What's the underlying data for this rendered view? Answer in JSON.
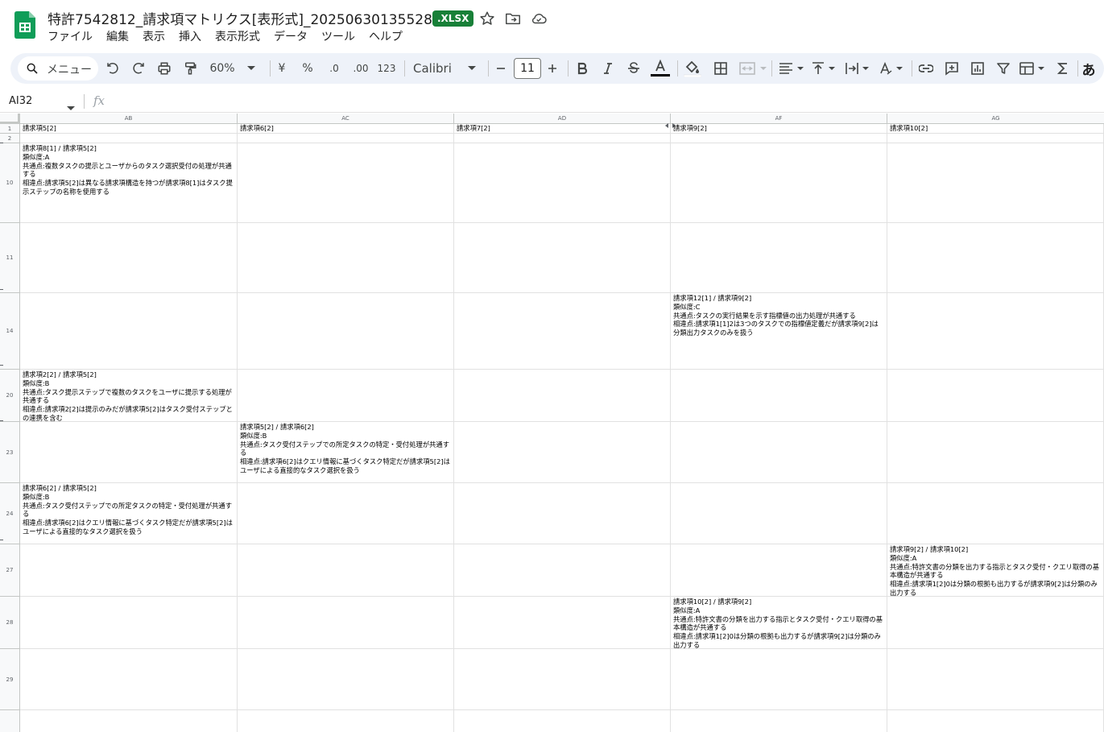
{
  "document": {
    "title": "特許7542812_請求項マトリクス[表形式]_20250630135528",
    "badge": ".XLSX"
  },
  "menu": [
    "ファイル",
    "編集",
    "表示",
    "挿入",
    "表示形式",
    "データ",
    "ツール",
    "ヘルプ"
  ],
  "toolbar": {
    "search_label": "メニュー",
    "zoom": "60%",
    "currency": "¥",
    "percent": "%",
    "decrease_decimal": ".0",
    "increase_decimal": ".00",
    "number_format": "123",
    "font": "Calibri",
    "font_size": "11",
    "input_mode": "あ"
  },
  "formula_bar": {
    "cell_ref": "AI32",
    "fx_label": "fx",
    "formula": ""
  },
  "columns": [
    "AB",
    "AC",
    "AD",
    "AF",
    "AG"
  ],
  "rows": [
    "1",
    "2",
    "10",
    "11",
    "14",
    "20",
    "23",
    "24",
    "27",
    "28",
    "29"
  ],
  "header_row": [
    "請求項5[2]",
    "請求項6[2]",
    "請求項7[2]",
    "請求項9[2]",
    "請求項10[2]"
  ],
  "cells": {
    "r10_ab": "請求項8[1] / 請求項5[2]\n類似度:A\n共通点:複数タスクの提示とユーザからのタスク選択受付の処理が共通する\n相違点:請求項5[2]は異なる請求項構造を持つが請求項8[1]はタスク提示ステップの名称を使用する",
    "r14_af": "請求項12[1] / 請求項9[2]\n類似度:C\n共通点:タスクの実行結果を示す指標値の出力処理が共通する\n相違点:請求項1[1]2は3つのタスクでの指標値定義だが請求項9[2]は分類出力タスクのみを扱う",
    "r20_ab": "請求項2[2] / 請求項5[2]\n類似度:B\n共通点:タスク提示ステップで複数のタスクをユーザに提示する処理が共通する\n相違点:請求項2[2]は提示のみだが請求項5[2]はタスク受付ステップとの連携を含む",
    "r23_ac": "請求項5[2] / 請求項6[2]\n類似度:B\n共通点:タスク受付ステップでの所定タスクの特定・受付処理が共通する\n相違点:請求項6[2]はクエリ情報に基づくタスク特定だが請求項5[2]はユーザによる直接的なタスク選択を扱う",
    "r24_ab": "請求項6[2] / 請求項5[2]\n類似度:B\n共通点:タスク受付ステップでの所定タスクの特定・受付処理が共通する\n相違点:請求項6[2]はクエリ情報に基づくタスク特定だが請求項5[2]はユーザによる直接的なタスク選択を扱う",
    "r27_ag": "請求項9[2] / 請求項10[2]\n類似度:A\n共通点:特許文書の分類を出力する指示とタスク受付・クエリ取得の基本構造が共通する\n相違点:請求項1[2]0は分類の根拠も出力するが請求項9[2]は分類のみ出力する",
    "r28_af": "請求項10[2] / 請求項9[2]\n類似度:A\n共通点:特許文書の分類を出力する指示とタスク受付・クエリ取得の基本構造が共通する\n相違点:請求項1[2]0は分類の根拠も出力するが請求項9[2]は分類のみ出力する"
  },
  "colors": {
    "accent_green": "#188038",
    "toolbar_bg": "#eef2f9",
    "gridline": "#e1e1e1",
    "header_bg": "#f8f9fa"
  },
  "icons": {
    "logo": "sheets-logo-icon",
    "star": "star-icon",
    "move": "folder-move-icon",
    "cloud": "cloud-status-icon"
  }
}
